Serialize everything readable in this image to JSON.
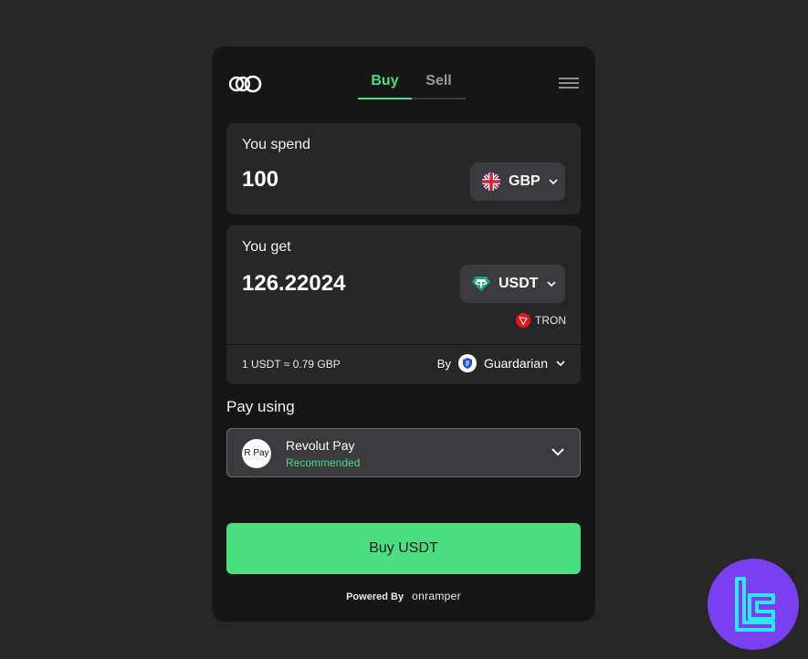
{
  "header": {
    "logo_icon": "onramper-rings-icon",
    "tabs": [
      {
        "label": "Buy",
        "active": true
      },
      {
        "label": "Sell",
        "active": false
      }
    ],
    "menu_icon": "hamburger-menu-icon"
  },
  "spend": {
    "label": "You spend",
    "amount": "100",
    "currency": "GBP",
    "currency_icon": "uk-flag-icon"
  },
  "get": {
    "label": "You get",
    "amount": "126.22024",
    "currency": "USDT",
    "currency_icon": "tether-icon",
    "network": "TRON",
    "network_icon": "tron-icon",
    "rate": "1 USDT ≈ 0.79 GBP",
    "by_label": "By",
    "provider": "Guardarian",
    "provider_icon": "guardarian-shield-icon"
  },
  "payment": {
    "label": "Pay using",
    "method": "Revolut Pay",
    "method_icon_text": "R Pay",
    "badge": "Recommended"
  },
  "cta": {
    "label": "Buy USDT"
  },
  "footer": {
    "powered_by": "Powered By",
    "brand": "onramper"
  },
  "colors": {
    "accent": "#4ade80",
    "background": "#272727",
    "widget": "#161616",
    "card": "#272727",
    "corner_badge": "#7b3ff2"
  }
}
